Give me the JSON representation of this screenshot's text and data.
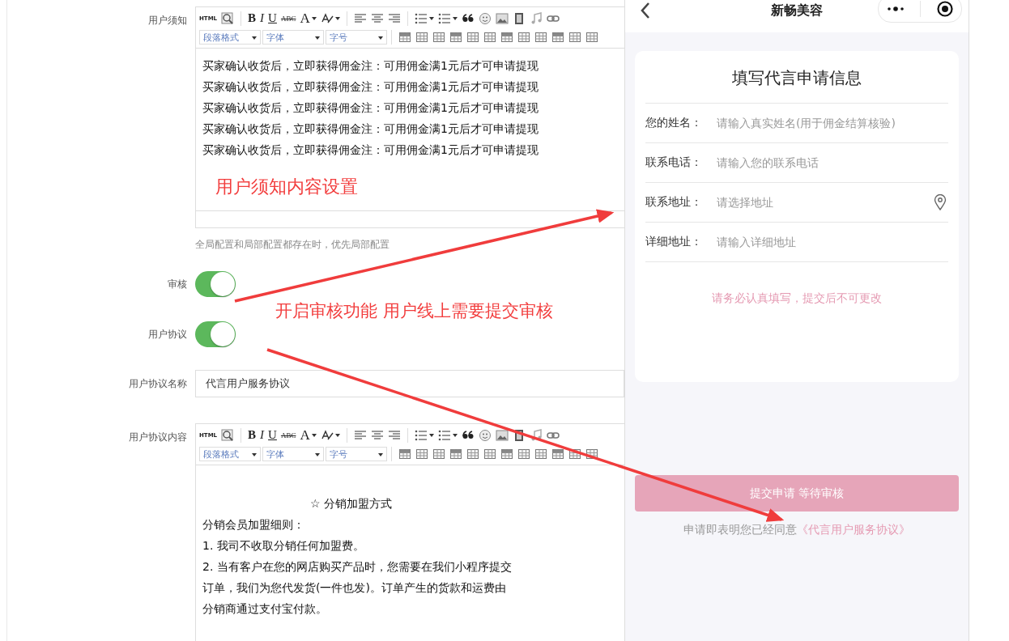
{
  "form": {
    "notice": {
      "label": "用户须知",
      "toolbar": {
        "buttons": [
          "HTML",
          "B",
          "I",
          "U",
          "ABC",
          "A"
        ],
        "selects": [
          "段落格式",
          "字体",
          "字号"
        ]
      },
      "lines": [
        "买家确认收货后，立即获得佣金注：可用佣金满1元后才可申请提现",
        "买家确认收货后，立即获得佣金注：可用佣金满1元后才可申请提现",
        "买家确认收货后，立即获得佣金注：可用佣金满1元后才可申请提现",
        "买家确认收货后，立即获得佣金注：可用佣金满1元后才可申请提现",
        "买家确认收货后，立即获得佣金注：可用佣金满1元后才可申请提现"
      ],
      "hint": "全局配置和局部配置都存在时，优先局部配置"
    },
    "toggles": [
      {
        "label": "审核",
        "on": true
      },
      {
        "label": "用户协议",
        "on": true
      }
    ],
    "agreement_name": {
      "label": "用户协议名称",
      "value": "代言用户服务协议"
    },
    "agreement_content": {
      "label": "用户协议内容",
      "toolbar": {
        "buttons": [
          "HTML",
          "B",
          "I",
          "U",
          "ABC",
          "A"
        ],
        "selects": [
          "段落格式",
          "字体",
          "字号"
        ]
      },
      "heading": "☆ 分销加盟方式",
      "lines": [
        "分销会员加盟细则：",
        "1. 我司不收取分销任何加盟费。",
        "2. 当有客户在您的网店购买产品时，您需要在我们小程序提交",
        "订单，我们为您代发货(一件也发)。订单产生的货款和运费由",
        "分销商通过支付宝付款。"
      ]
    }
  },
  "annotations": [
    "用户须知内容设置",
    "开启审核功能 用户线上需要提交审核"
  ],
  "phone": {
    "title": "新畅美容",
    "card_title": "填写代言申请信息",
    "fields": [
      {
        "label": "您的姓名：",
        "placeholder": "请输入真实姓名(用于佣金结算核验)",
        "kind": "text"
      },
      {
        "label": "联系电话：",
        "placeholder": "请输入您的联系电话",
        "kind": "text"
      },
      {
        "label": "联系地址：",
        "placeholder": "请选择地址",
        "kind": "location"
      },
      {
        "label": "详细地址：",
        "placeholder": "请输入详细地址",
        "kind": "text"
      }
    ],
    "tip": "请务必认真填写，提交后不可更改",
    "submit": "提交申请 等待审核",
    "consent": "申请即表明您已经同意",
    "consent_link": "《代言用户服务协议》"
  }
}
